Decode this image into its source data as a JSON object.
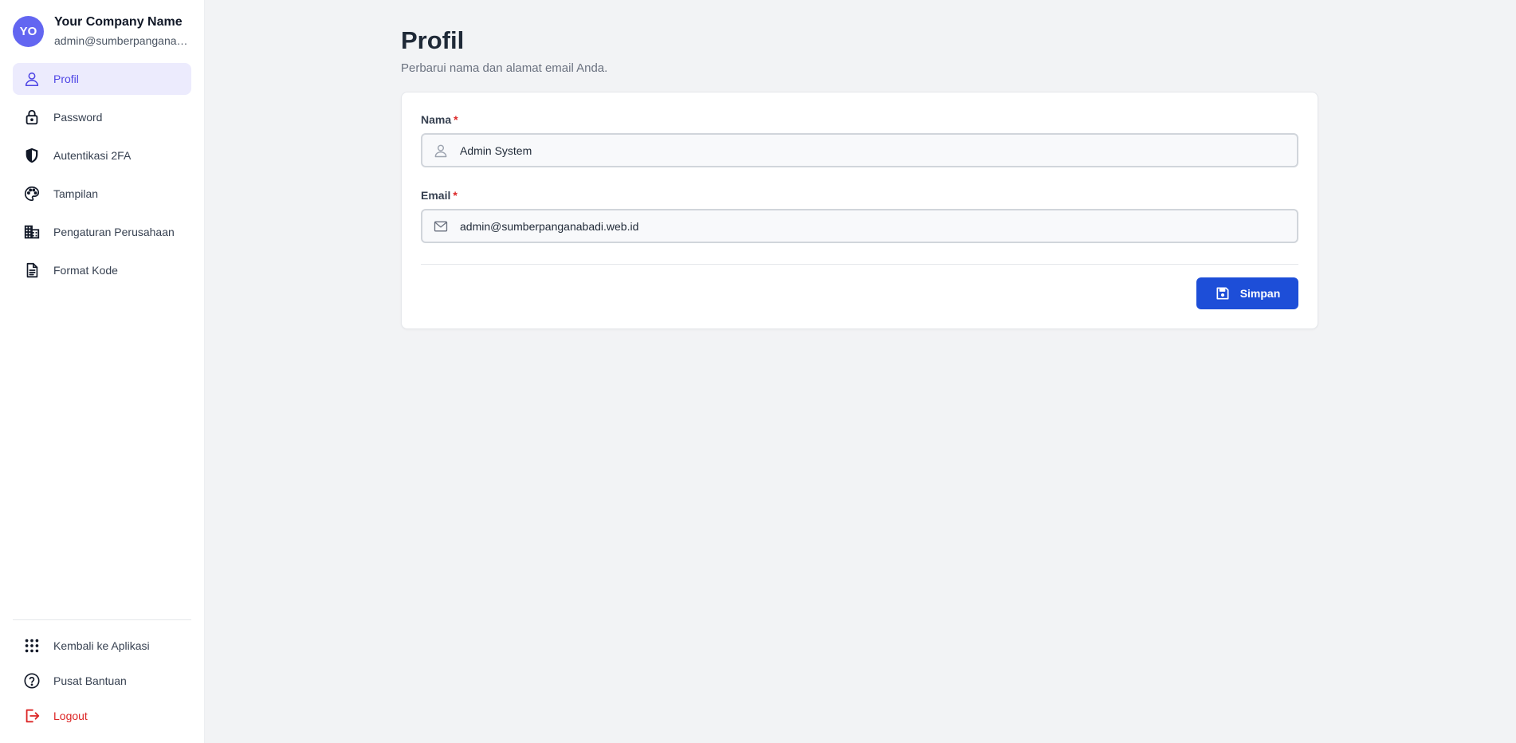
{
  "account": {
    "initials": "YO",
    "company_name": "Your Company Name",
    "email": "admin@sumberpanganabadi.web.id"
  },
  "nav": {
    "items": [
      {
        "label": "Profil",
        "icon": "user-icon",
        "active": true
      },
      {
        "label": "Password",
        "icon": "lock-icon"
      },
      {
        "label": "Autentikasi 2FA",
        "icon": "shield-icon"
      },
      {
        "label": "Tampilan",
        "icon": "palette-icon"
      },
      {
        "label": "Pengaturan Perusahaan",
        "icon": "building-icon"
      },
      {
        "label": "Format Kode",
        "icon": "document-icon"
      }
    ],
    "bottom_items": [
      {
        "label": "Kembali ke Aplikasi",
        "icon": "grid-icon"
      },
      {
        "label": "Pusat Bantuan",
        "icon": "help-circle-icon"
      },
      {
        "label": "Logout",
        "icon": "logout-icon"
      }
    ]
  },
  "page": {
    "title": "Profil",
    "subtitle": "Perbarui nama dan alamat email Anda."
  },
  "form": {
    "name_label": "Nama",
    "name_value": "Admin System",
    "email_label": "Email",
    "email_value": "admin@sumberpanganabadi.web.id",
    "required_mark": "*",
    "save_label": "Simpan"
  },
  "colors": {
    "accent": "#4f46e5",
    "avatar": "#6366f1",
    "active_bg": "#ecebfd",
    "primary_button": "#1d4ed8",
    "danger": "#dc2626"
  }
}
